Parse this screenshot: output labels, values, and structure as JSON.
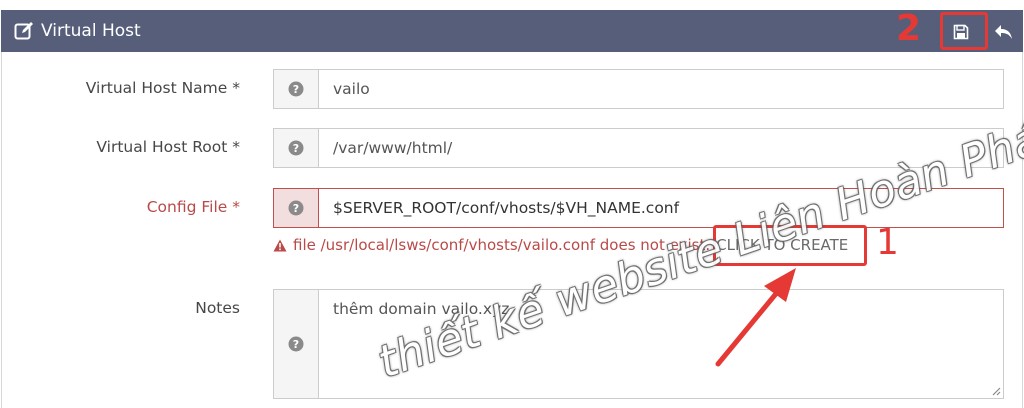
{
  "header": {
    "title": "Virtual Host",
    "title_icon": "edit-icon",
    "save_icon": "floppy-disk-icon",
    "back_icon": "undo-arrow-icon",
    "background_color": "#565e7a"
  },
  "form": {
    "fields": [
      {
        "label": "Virtual Host Name *",
        "value": "vailo",
        "help_icon": "question-circle-icon"
      },
      {
        "label": "Virtual Host Root *",
        "value": "/var/www/html/",
        "help_icon": "question-circle-icon"
      },
      {
        "label": "Config File *",
        "value": "$SERVER_ROOT/conf/vhosts/$VH_NAME.conf",
        "help_icon": "question-circle-icon",
        "state": "error"
      },
      {
        "label": "Notes",
        "value": "thêm domain vailo.xyz",
        "help_icon": "question-circle-icon"
      }
    ],
    "config_error": {
      "icon": "warning-triangle-icon",
      "message": "file /usr/local/lsws/conf/vhosts/vailo.conf does not exist.",
      "action_label": "CLICK TO CREATE"
    }
  },
  "annotations": {
    "step1_label": "1",
    "step2_label": "2",
    "color": "#e53935"
  },
  "watermark": "thiết kế website Liên Hoàn Phát",
  "colors": {
    "error": "#b94a48",
    "error_border": "#c0504d",
    "error_addon_bg": "#f2dede"
  }
}
